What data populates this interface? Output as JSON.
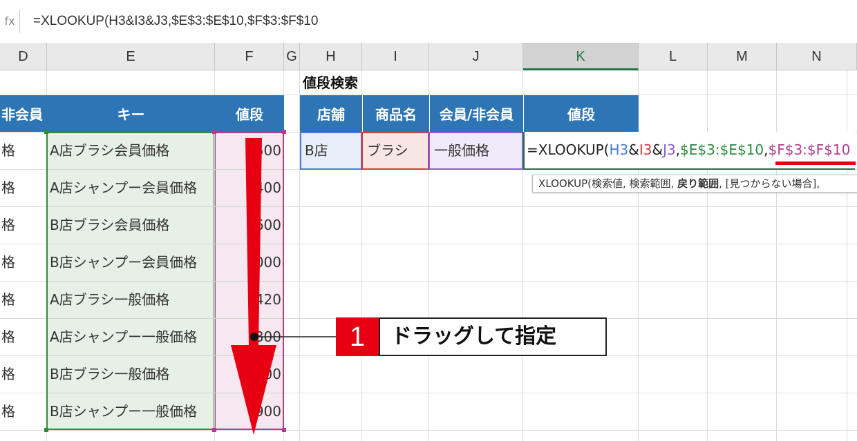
{
  "formula_bar": {
    "fx_icon": "fx-icon",
    "formula": "=XLOOKUP(H3&I3&J3,$E$3:$E$10,$F$3:$F$10"
  },
  "columns": [
    "D",
    "E",
    "F",
    "G",
    "H",
    "I",
    "J",
    "K",
    "L",
    "M",
    "N"
  ],
  "left_table": {
    "headers": {
      "d": "非会員",
      "e": "キー",
      "f": "値段"
    },
    "rows": [
      {
        "d": "格",
        "e": "A店ブラシ会員価格",
        "f": "500"
      },
      {
        "d": "格",
        "e": "A店シャンプー会員価格",
        "f": "400"
      },
      {
        "d": "格",
        "e": "B店ブラシ会員価格",
        "f": "600"
      },
      {
        "d": "格",
        "e": "B店シャンプー会員価格",
        "f": "1000"
      },
      {
        "d": "格",
        "e": "A店ブラシ一般価格",
        "f": "420"
      },
      {
        "d": "格",
        "e": "A店シャンプー一般価格",
        "f": "300"
      },
      {
        "d": "格",
        "e": "B店ブラシ一般価格",
        "f": "700"
      },
      {
        "d": "格",
        "e": "B店シャンプー一般価格",
        "f": "900"
      }
    ]
  },
  "search": {
    "title": "値段検索",
    "headers": {
      "h": "店舗",
      "i": "商品名",
      "j": "会員/非会員",
      "k": "値段"
    },
    "values": {
      "h": "B店",
      "i": "ブラシ",
      "j": "一般価格"
    },
    "edit_formula_parts": {
      "p1": "=XLOOKUP(",
      "p2": "H3",
      "p3": "&",
      "p4": "I3",
      "p5": "&",
      "p6": "J3",
      "p7": ",",
      "p8": "$E$3:$E$10",
      "p9": ",",
      "p10": "$F$3:$F$10"
    },
    "tooltip": {
      "t1": "XLOOKUP(検索値, 検索範囲, ",
      "t2": "戻り範囲",
      "t3": ", [見つからない場合],"
    }
  },
  "callout": {
    "number": "1",
    "text": "ドラッグして指定"
  },
  "colors": {
    "header_blue": "#2e75b6",
    "range_green": "#e6f0e6",
    "range_pink": "#f6e7f1",
    "accent_red": "#e60012"
  }
}
